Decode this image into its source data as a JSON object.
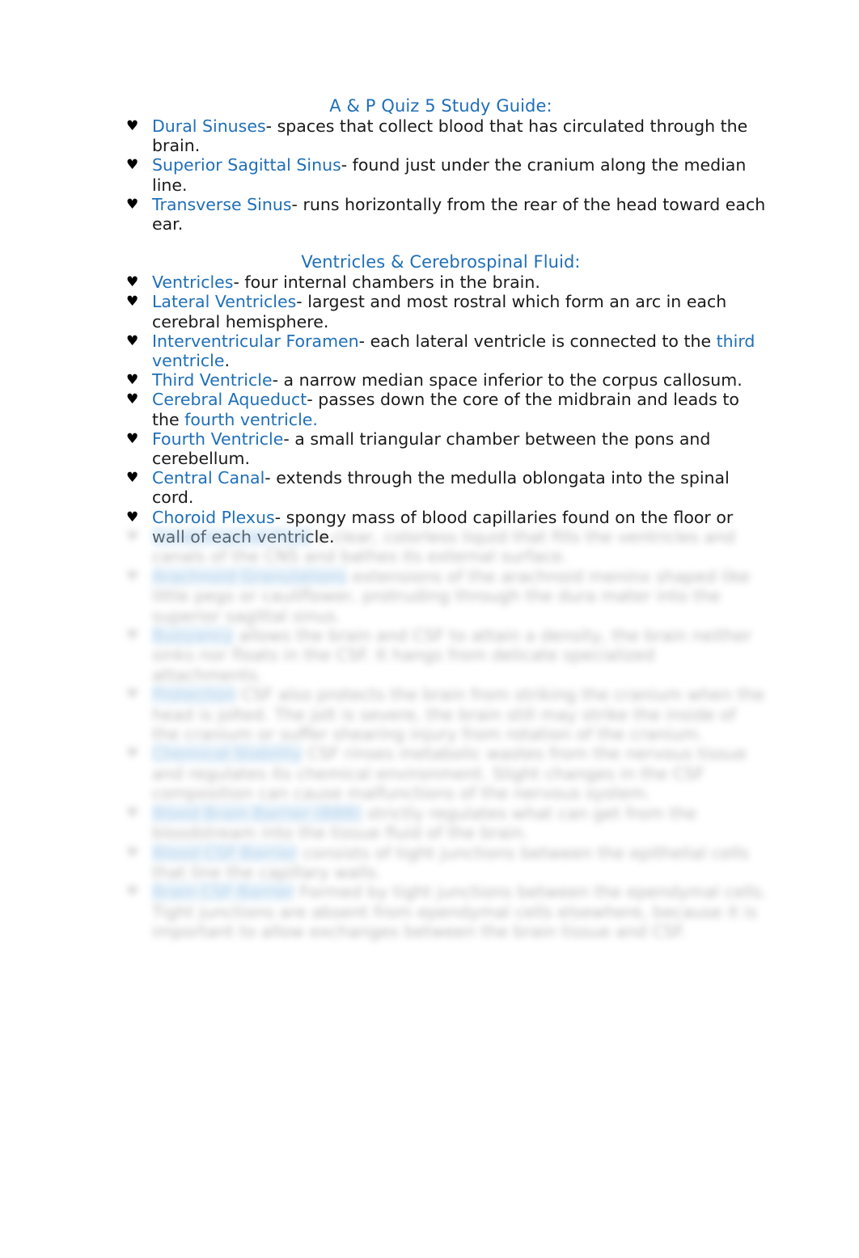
{
  "document": {
    "title": "A & P Quiz 5 Study Guide:",
    "bullet_glyph": "♥",
    "accent_color": "#1f6fb8",
    "body_color": "#1a1a1a",
    "sections": [
      {
        "heading": "A & P Quiz 5 Study Guide:",
        "items": [
          {
            "term": "Dural Sinuses",
            "definition": "- spaces that collect blood that has circulated through the brain."
          },
          {
            "term": "Superior Sagittal Sinus",
            "definition": "- found just under the cranium along the median line."
          },
          {
            "term": "Transverse Sinus",
            "definition": "- runs horizontally from the rear of the head toward each ear."
          }
        ]
      },
      {
        "heading": "Ventricles & Cerebrospinal Fluid:",
        "items": [
          {
            "term": "Ventricles",
            "definition": "- four internal chambers in the brain."
          },
          {
            "term": "Lateral Ventricles",
            "definition": "- largest and most rostral which form an arc in each cerebral hemisphere."
          },
          {
            "term": "Interventricular Foramen",
            "definition": "- each lateral ventricle is connected to the ",
            "inline_blue": "third ventricle",
            "definition_tail": "."
          },
          {
            "term": "Third Ventricle",
            "definition": "- a narrow median space inferior to the corpus callosum."
          },
          {
            "term": "Cerebral Aqueduct",
            "definition": "- passes down the core of the midbrain and leads to the ",
            "inline_blue": "fourth ventricle.",
            "definition_tail": ""
          },
          {
            "term": "Fourth Ventricle",
            "definition": "- a small triangular chamber between the pons and cerebellum."
          },
          {
            "term": "Central Canal",
            "definition": "- extends through the medulla oblongata into the spinal cord."
          },
          {
            "term": "Choroid Plexus",
            "definition": "- spongy mass of blood capillaries found on the floor or wall of each ventricle."
          }
        ]
      }
    ],
    "obscured_section": {
      "note": "blurred",
      "items": [
        {
          "term": "Cerebrospinal Fluid",
          "definition": "a clear, colorless liquid that fills the ventricles and canals of the CNS and bathes its external surface."
        },
        {
          "term": "Arachnoid Granulations",
          "definition": "extensions of the arachnoid meninx shaped like little pegs or cauliflower, protruding through the dura mater into the superior sagittal sinus."
        },
        {
          "term": "Buoyancy",
          "definition": "allows the brain and CSF to attain a density, the brain neither sinks nor floats in the CSF. It hangs from delicate specialized attachments."
        },
        {
          "term": "Protection",
          "definition": "CSF also protects the brain from striking the cranium when the head is jolted. The jolt is severe, the brain still may strike the inside of the cranium or suffer shearing injury from rotation of the cranium."
        },
        {
          "term": "Chemical Stability",
          "definition": "CSF rinses metabolic wastes from the nervous tissue and regulates its chemical environment. Slight changes in the CSF composition can cause malfunctions of the nervous system."
        },
        {
          "term": "Blood Brain Barrier (BBB)",
          "definition": "strictly regulates what can get from the bloodstream into the tissue fluid of the brain."
        },
        {
          "term": "Blood CSF Barrier",
          "definition": "consists of tight junctions between the epithelial cells that line the capillary walls."
        },
        {
          "term": "Brain CSF Barrier",
          "definition": "Formed by tight junctions between the ependymal cells. Tight junctions are absent from ependymal cells elsewhere, because it is important to allow exchanges between the brain tissue and CSF."
        }
      ]
    }
  }
}
